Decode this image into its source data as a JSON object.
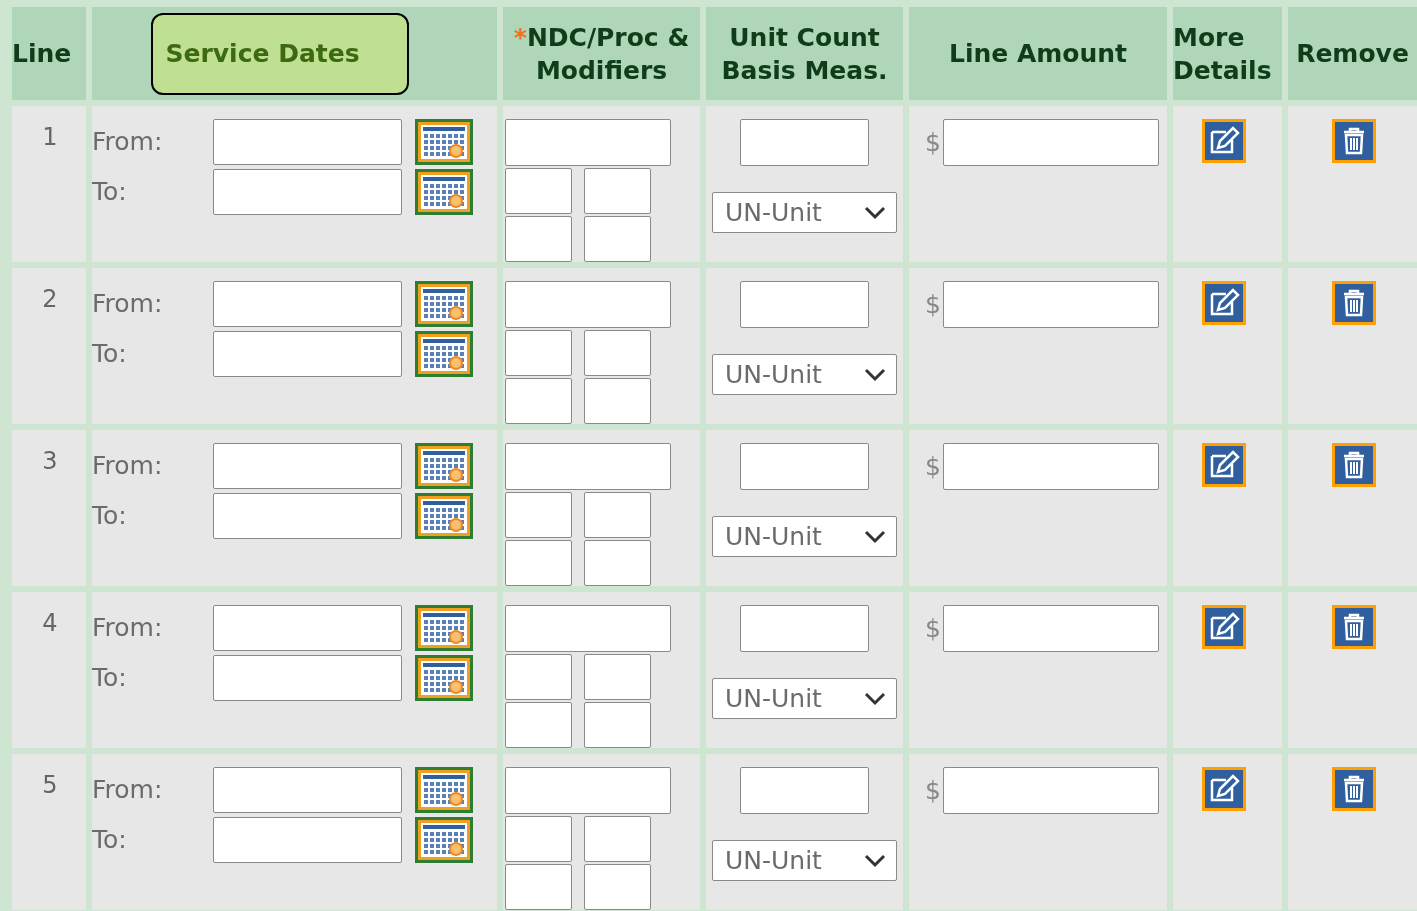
{
  "columns": [
    {
      "label": "Line",
      "highlighted": false
    },
    {
      "label": "Service Dates",
      "highlighted": true
    },
    {
      "label": "NDC/Proc & Modifiers",
      "highlighted": false,
      "required_mark": "*"
    },
    {
      "label": "Unit Count Basis Meas.",
      "highlighted": false
    },
    {
      "label": "Line Amount",
      "highlighted": false
    },
    {
      "label": "More Details",
      "highlighted": false
    },
    {
      "label": "Remove",
      "highlighted": false
    }
  ],
  "rows": [
    {
      "line": "1",
      "from_label": "From:",
      "to_label": "To:",
      "unit": "UN-Unit",
      "currency": "$"
    },
    {
      "line": "2",
      "from_label": "From:",
      "to_label": "To:",
      "unit": "UN-Unit",
      "currency": "$"
    },
    {
      "line": "3",
      "from_label": "From:",
      "to_label": "To:",
      "unit": "UN-Unit",
      "currency": "$"
    },
    {
      "line": "4",
      "from_label": "From:",
      "to_label": "To:",
      "unit": "UN-Unit",
      "currency": "$"
    },
    {
      "line": "5",
      "from_label": "From:",
      "to_label": "To:",
      "unit": "UN-Unit",
      "currency": "$"
    }
  ]
}
